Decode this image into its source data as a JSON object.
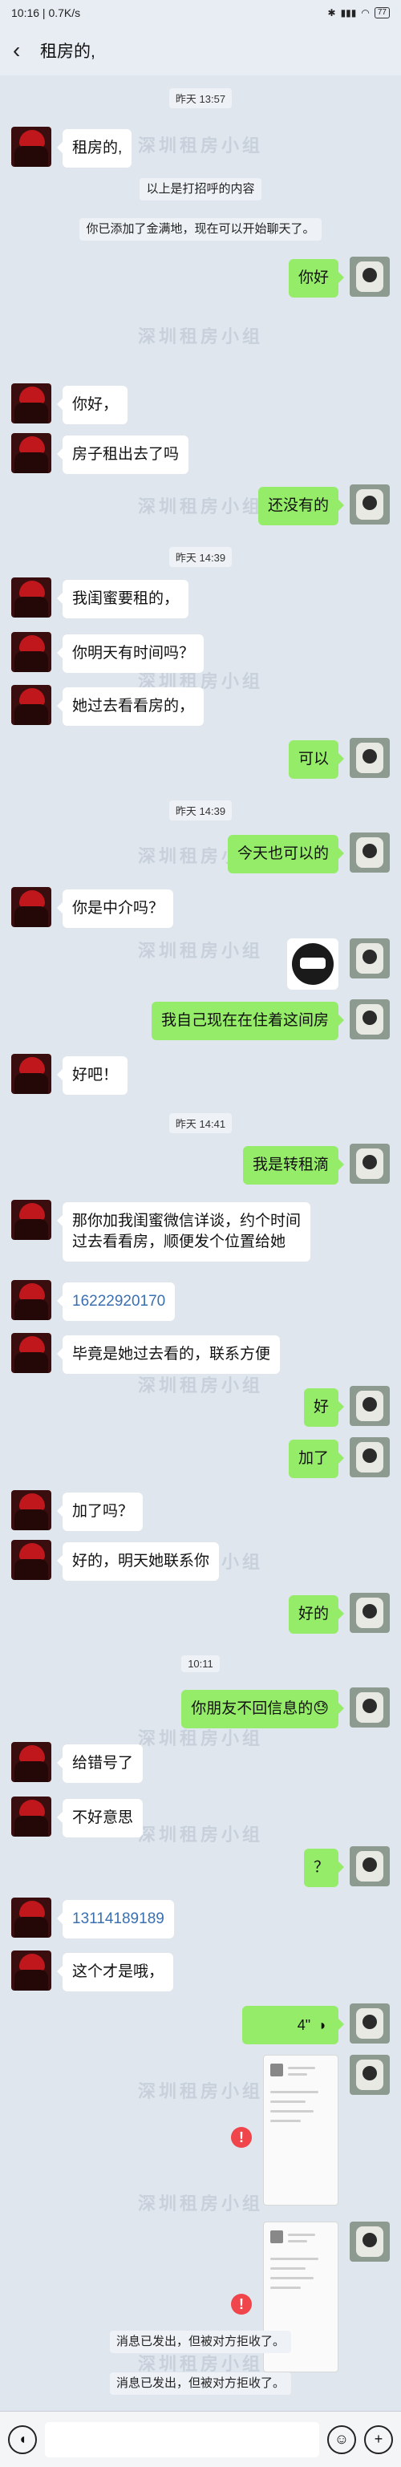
{
  "status_bar": {
    "time": "10:16 | 0.7K/s",
    "battery": "77"
  },
  "header": {
    "title": "租房的,"
  },
  "watermark": "深圳租房小组",
  "messages": {
    "t1": "昨天 13:57",
    "m1": "租房的,",
    "s1": "以上是打招呼的内容",
    "s2": "你已添加了金满地，现在可以开始聊天了。",
    "m2": "你好",
    "m3": "你好，",
    "m4": "房子租出去了吗",
    "m5": "还没有的",
    "t2": "昨天 14:39",
    "m6": "我闺蜜要租的，",
    "m7": "你明天有时间吗？",
    "m8": "她过去看看房的，",
    "m9": "可以",
    "t3": "昨天 14:39",
    "m10": "今天也可以的",
    "m11": "你是中介吗？",
    "m12": "我自己现在在住着这间房",
    "m13": "好吧！",
    "t4": "昨天 14:41",
    "m14": "我是转租滴",
    "m15a": "那你加我闺蜜微信详谈，约个时间",
    "m15b": "过去看看房，顺便发个位置给她",
    "m16": "16222920170",
    "m17": "毕竟是她过去看的，联系方便",
    "m18": "好",
    "m19": "加了",
    "m20": "加了吗？",
    "m21": "好的，明天她联系你",
    "m22": "好的",
    "t5": "10:11",
    "m23": "你朋友不回信息的😓",
    "m24": "给错号了",
    "m25": "不好意思",
    "m26": "？",
    "m27": "13114189189",
    "m28": "这个才是哦，",
    "voice_duration": "4\"",
    "s3": "消息已发出，但被对方拒收了。",
    "s4": "消息已发出，但被对方拒收了。"
  }
}
